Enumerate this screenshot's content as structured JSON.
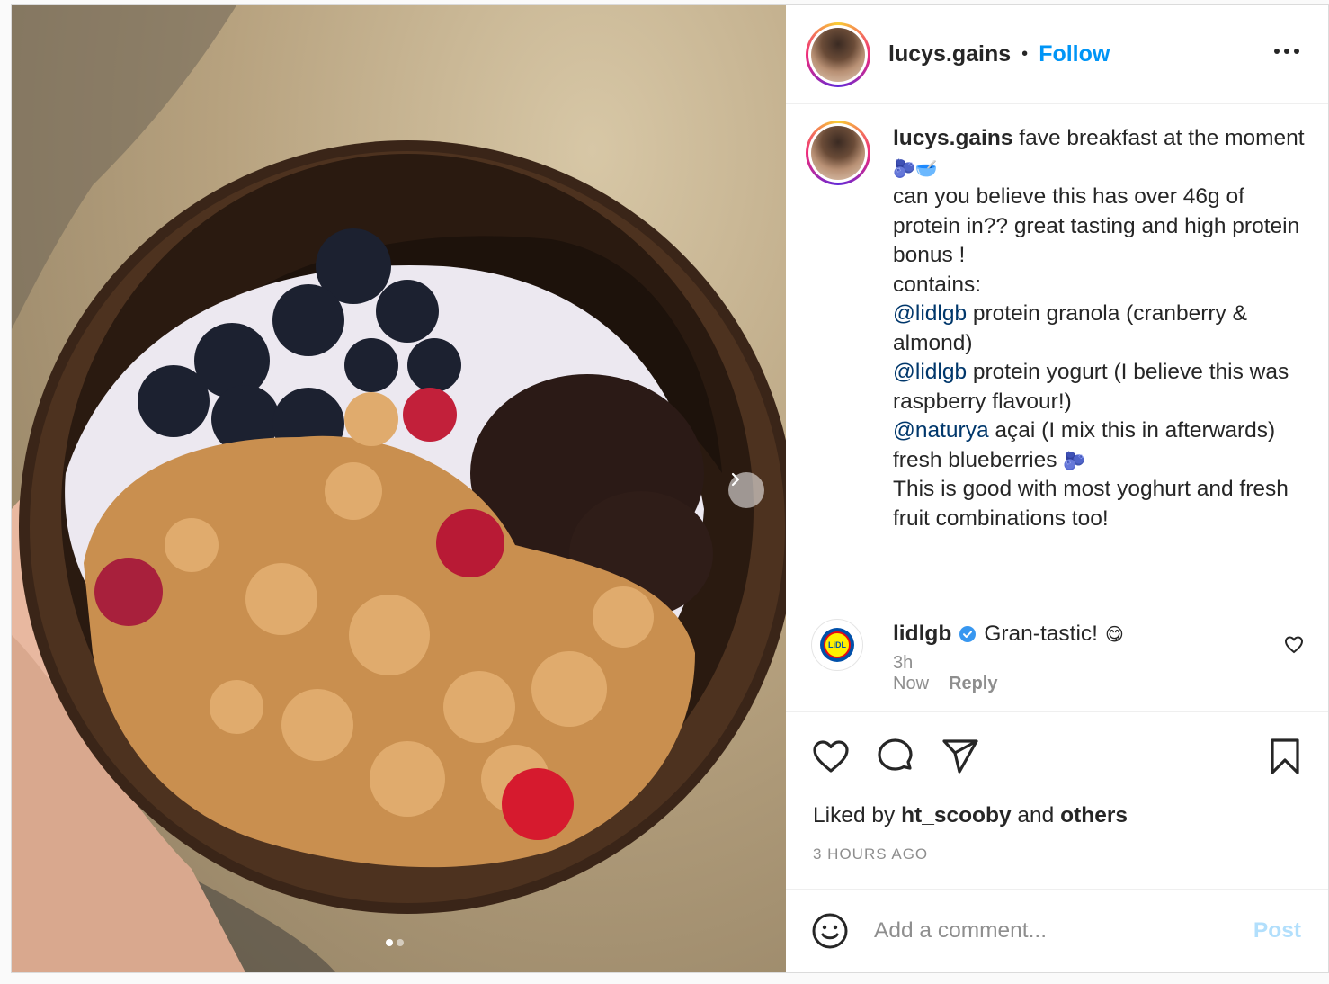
{
  "header": {
    "username": "lucys.gains",
    "separator": "•",
    "follow_label": "Follow"
  },
  "caption": {
    "username": "lucys.gains",
    "line1": "fave breakfast at the moment",
    "line1_emoji": "🫐🥣",
    "line2": "can you believe this has over 46g of protein in?? great tasting and high protein bonus !",
    "line3": "contains:",
    "item1_mention": "@lidlgb",
    "item1_text": "protein granola (cranberry & almond)",
    "item2_mention": "@lidlgb",
    "item2_text": "protein yogurt (I believe this was raspberry flavour!)",
    "item3_mention": "@naturya",
    "item3_text": "açai (I mix this in afterwards)",
    "item4_text": "fresh blueberries",
    "item4_emoji": "🫐",
    "line_last": "This is good with most yoghurt and fresh fruit combinations too!",
    "time": "3h"
  },
  "comment": {
    "username": "lidlgb",
    "text": "Gran-tastic!",
    "emoji": "😋",
    "logo_text": "LiDL",
    "time": "Now",
    "reply_label": "Reply"
  },
  "likes": {
    "prefix": "Liked by",
    "user": "ht_scooby",
    "and": "and",
    "others": "others"
  },
  "timestamp": "3 HOURS AGO",
  "add_comment": {
    "placeholder": "Add a comment...",
    "post_label": "Post"
  },
  "carousel": {
    "current_slide": 1,
    "total_slides": 2
  },
  "colors": {
    "accent": "#0095f6",
    "mention": "#00376b",
    "post_disabled": "#b2dffc",
    "muted": "#8e8e8e"
  },
  "icons": [
    "more-icon",
    "heart-icon",
    "comment-icon",
    "share-icon",
    "bookmark-icon",
    "emoji-icon",
    "verified-icon",
    "chevron-right-icon"
  ]
}
